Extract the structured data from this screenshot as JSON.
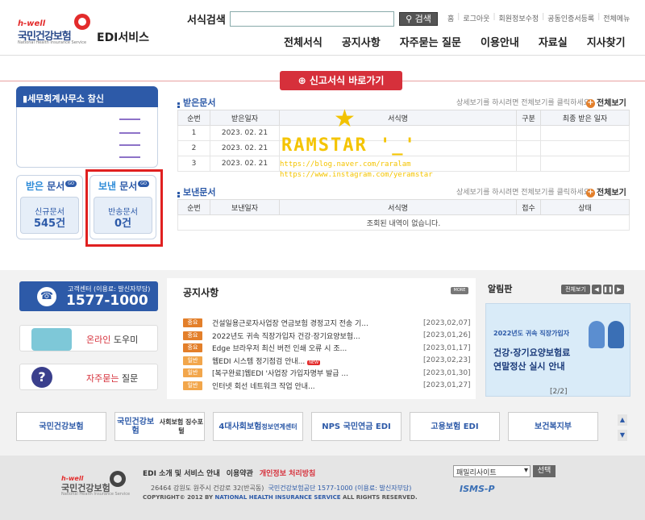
{
  "header": {
    "logo_hwell": "h-well",
    "logo_name": "국민건강보험",
    "logo_sub": "National Health Insurance Service",
    "edi_title": "EDI서비스",
    "search_label": "서식검색",
    "search_button": "검색",
    "util_links": [
      "홈",
      "로그아웃",
      "회원정보수정",
      "공동인증서등록",
      "전체메뉴"
    ],
    "gnb": [
      "전체서식",
      "공지사항",
      "자주묻는 질문",
      "이용안내",
      "자료실",
      "지사찾기"
    ]
  },
  "shortcut": "신고서식 바로가기",
  "left": {
    "office_title": "세무회계사무소 참신",
    "received_title_a": "받은",
    "received_title_b": " 문서",
    "sent_title_a": "보낸",
    "sent_title_b": " 문서",
    "go": "GO",
    "new_doc_label": "신규문서",
    "new_doc_count": "545건",
    "returned_label": "반송문서",
    "returned_count": "0건"
  },
  "received": {
    "title": "받은문서",
    "hint": "상세보기를 하시려면 전체보기를 클릭하세요.",
    "full_view": "전체보기",
    "columns": [
      "순번",
      "받은일자",
      "서식명",
      "구분",
      "최종 받은 일자"
    ],
    "rows": [
      {
        "no": "1",
        "date": "2023. 02. 21"
      },
      {
        "no": "2",
        "date": "2023. 02. 21"
      },
      {
        "no": "3",
        "date": "2023. 02. 21"
      }
    ]
  },
  "sent": {
    "title": "보낸문서",
    "hint": "상세보기를 하시려면 전체보기를 클릭하세요.",
    "full_view": "전체보기",
    "columns": [
      "순번",
      "보낸일자",
      "서식명",
      "접수",
      "상태"
    ],
    "empty": "조회된 내역이 없습니다."
  },
  "watermark": {
    "star": "★",
    "text": "RAMSTAR '_'",
    "url1": "https://blog.naver.com/raralam",
    "url2": "https://www.instagram.com/yeramstar"
  },
  "callcenter": {
    "label": "고객센터 (이용료: 발신자부담)",
    "number": "1577-1000"
  },
  "help": {
    "online_a": "온라인",
    "online_b": " 도우미",
    "faq_a": "자주묻는",
    "faq_b": " 질문"
  },
  "notice": {
    "title": "공지사항",
    "more": "MORE",
    "items": [
      {
        "tag": "중요",
        "text": "건설일용근로자사업장 연금보험 경정고지 전송 기...",
        "date": "[2023,02,07]",
        "new": ""
      },
      {
        "tag": "중요",
        "text": "2022년도 귀속 직장가입자 건강·장기요양보험...",
        "date": "[2023,01,26]",
        "new": ""
      },
      {
        "tag": "중요",
        "text": "Edge 브라우저 최신 버전 인쇄 오류 시 조...",
        "date": "[2023,01,17]",
        "new": ""
      },
      {
        "tag": "일반",
        "text": "웹EDI 시스템 정기점검 안내...",
        "date": "[2023,02,23]",
        "new": "NEW"
      },
      {
        "tag": "일반",
        "text": "[복구완료]웹EDI '사업장 가입자명부 발급 ...",
        "date": "[2023,01,30]",
        "new": ""
      },
      {
        "tag": "일반",
        "text": "인터넷 회선 네트워크 작업 안내...",
        "date": "[2023,01,27]",
        "new": ""
      }
    ]
  },
  "alarm": {
    "title": "알림판",
    "full_view": "전체보기",
    "banner_line1": "2022년도 귀속 직장가입자",
    "banner_line2": "건강·장기요양보험료",
    "banner_line3": "연말정산 실시 안내",
    "page": "[2/2]"
  },
  "partners": [
    {
      "name": "국민건강보험",
      "sub": ""
    },
    {
      "name": "국민건강보험",
      "sub": "사회보험 징수포털"
    },
    {
      "name": "4대사회보험",
      "sub": "정보연계센터"
    },
    {
      "name": "NPS 국민연금 EDI",
      "sub": ""
    },
    {
      "name": "고용보험 EDI",
      "sub": ""
    },
    {
      "name": "보건복지부",
      "sub": ""
    }
  ],
  "footer": {
    "links": [
      "EDI 소개 및 서비스 안내",
      "이용약관",
      "개인정보 처리방침"
    ],
    "address": "26464 강원도 원주시 건강로 32(반곡동)",
    "address_call": "국민건강보험공단 1577-1000 (이용료: 발신자부담)",
    "copyright_a": "COPYRIGHT© 2012 BY ",
    "copyright_b": "NATIONAL HEALTH INSURANCE SERVICE",
    "copyright_c": " ALL RIGHTS RESERVED.",
    "family_site": "패밀리사이트",
    "select_btn": "선택",
    "isms": "ISMS-P"
  },
  "colors": {
    "brand_blue": "#2d5aa8",
    "brand_red": "#d6303b",
    "accent_orange": "#e37f2a"
  }
}
